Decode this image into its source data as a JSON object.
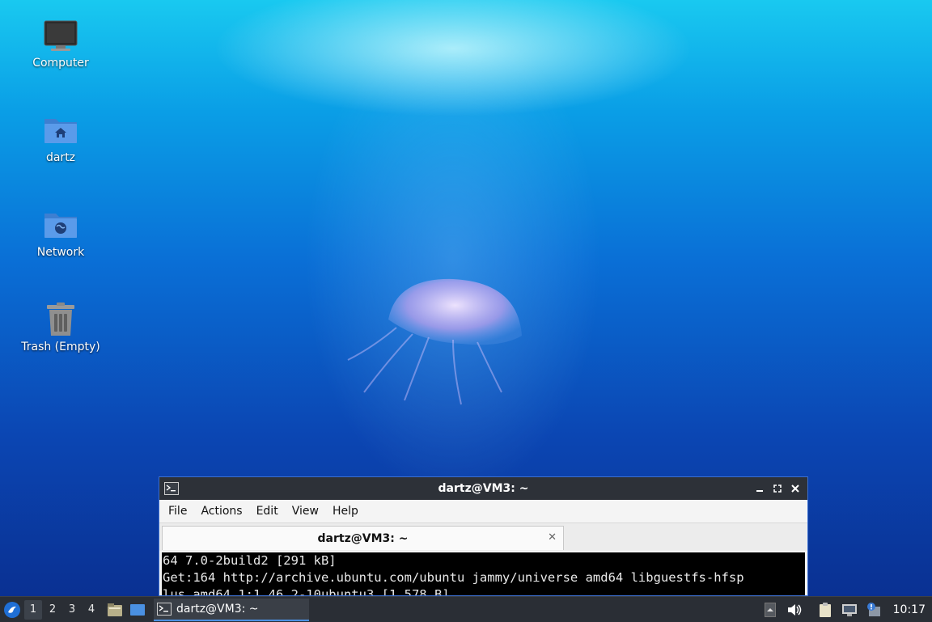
{
  "desktop": {
    "icons": [
      {
        "label": "Computer",
        "icon": "computer-icon"
      },
      {
        "label": "dartz",
        "icon": "home-folder-icon"
      },
      {
        "label": "Network",
        "icon": "network-folder-icon"
      },
      {
        "label": "Trash (Empty)",
        "icon": "trash-icon"
      }
    ]
  },
  "window": {
    "title": "dartz@VM3: ~",
    "menu": [
      "File",
      "Actions",
      "Edit",
      "View",
      "Help"
    ],
    "tab_title": "dartz@VM3: ~",
    "terminal_lines": [
      "64 7.0-2build2 [291 kB]",
      "Get:164 http://archive.ubuntu.com/ubuntu jammy/universe amd64 libguestfs-hfsp",
      "lus amd64 1:1.46.2-10ubuntu3 [1,578 B]"
    ]
  },
  "taskbar": {
    "workspaces": [
      "1",
      "2",
      "3",
      "4"
    ],
    "active_workspace": "1",
    "task_label": "dartz@VM3: ~",
    "clock": "10:17"
  },
  "colors": {
    "accent": "#4a90e2",
    "taskbar_bg": "#2a2e35",
    "titlebar_bg": "#2d3138"
  }
}
